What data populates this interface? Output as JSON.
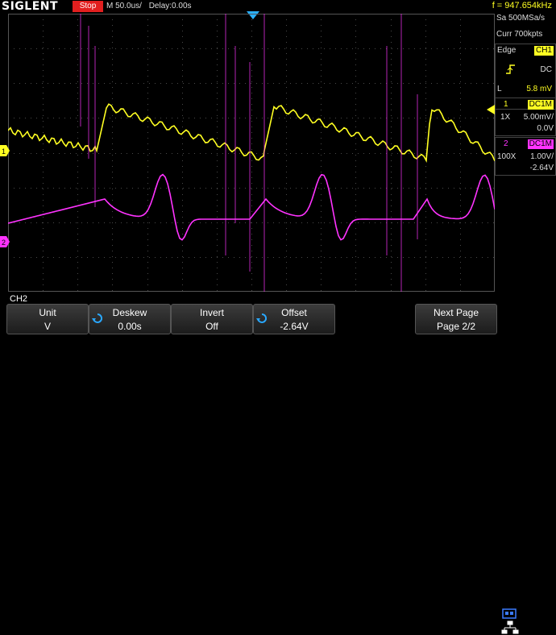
{
  "brand": "SIGLENT",
  "status": "Stop",
  "header": {
    "timebase": "M 50.0us/",
    "delay": "Delay:0.00s",
    "frequency": "f = 947.654kHz"
  },
  "acquisition": {
    "sample_rate": "Sa 500MSa/s",
    "memory": "Curr 700kpts"
  },
  "trigger": {
    "type": "Edge",
    "source": "CH1",
    "coupling": "DC",
    "level_label": "L",
    "level": "5.8 mV"
  },
  "channels": [
    {
      "index": "1",
      "coupling": "DC1M",
      "probe": "1X",
      "scale": "5.00mV/",
      "offset": "0.0V",
      "color": "#ffff22"
    },
    {
      "index": "2",
      "coupling": "DC1M",
      "probe": "100X",
      "scale": "1.00V/",
      "offset": "-2.64V",
      "color": "#ff33ff"
    }
  ],
  "markers": {
    "ch1": "1",
    "ch2": "2"
  },
  "menu_title": "CH2",
  "softkeys": [
    {
      "top": "Unit",
      "bottom": "V"
    },
    {
      "top": "Deskew",
      "bottom": "0.00s"
    },
    {
      "top": "Invert",
      "bottom": "Off"
    },
    {
      "top": "Offset",
      "bottom": "-2.64V"
    },
    {
      "top": "Next Page",
      "bottom": "Page 2/2"
    }
  ],
  "colors": {
    "ch1": "#ffff22",
    "ch2": "#ff33ff",
    "status": "#e21f1f",
    "trigger_marker": "#2ab0ff",
    "grid": "#3a3a3a"
  }
}
